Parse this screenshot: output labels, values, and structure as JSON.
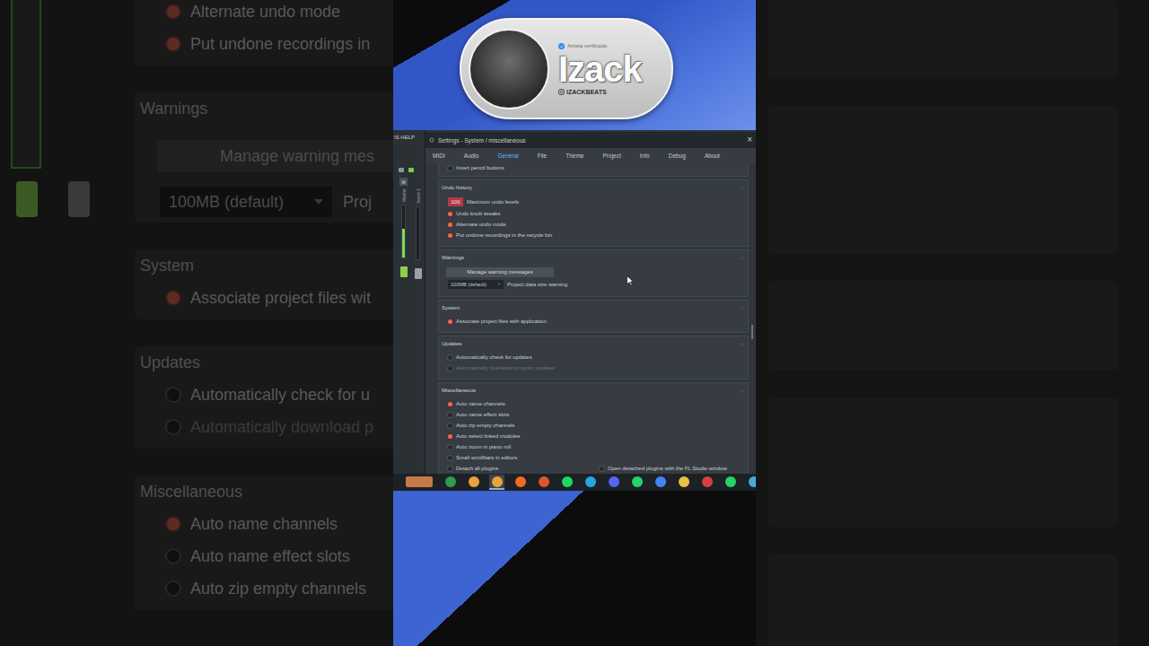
{
  "backdrop": {
    "sections": [
      {
        "items": [
          {
            "kind": "radio",
            "label": "Alternate undo mode",
            "on": true,
            "disabled": false
          },
          {
            "kind": "radio",
            "label": "Put undone recordings in",
            "on": true,
            "disabled": false
          }
        ]
      },
      {
        "title": "Warnings",
        "items": [
          {
            "kind": "button",
            "label": "Manage warning mes"
          },
          {
            "kind": "dropdown",
            "value": "100MB (default)",
            "label": "Proj"
          }
        ]
      },
      {
        "title": "System",
        "items": [
          {
            "kind": "radio",
            "label": "Associate project files wit",
            "on": true,
            "disabled": false
          }
        ]
      },
      {
        "title": "Updates",
        "items": [
          {
            "kind": "radio",
            "label": "Automatically check for u",
            "on": false,
            "disabled": false
          },
          {
            "kind": "radio",
            "label": "Automatically download p",
            "on": false,
            "disabled": true
          }
        ]
      },
      {
        "title": "Miscellaneous",
        "items": [
          {
            "kind": "radio",
            "label": "Auto name channels",
            "on": true,
            "disabled": false
          },
          {
            "kind": "radio",
            "label": "Auto name effect slots",
            "on": false,
            "disabled": false
          },
          {
            "kind": "radio",
            "label": "Auto zip empty channels",
            "on": false,
            "disabled": false
          }
        ]
      }
    ]
  },
  "badge": {
    "verified_label": "Artista verificado",
    "name": "Izack",
    "handle": "IZACKBEATS"
  },
  "screenshot": {
    "menu": "IS HELP",
    "mixer": {
      "mute_label": "M",
      "tracks": [
        {
          "name": "Master",
          "level": 0.55
        },
        {
          "name": "Insert 1",
          "level": 0
        }
      ]
    },
    "window": {
      "title": "Settings - System / miscellaneous",
      "close": "×"
    },
    "tabs": [
      {
        "label": "MIDI",
        "selected": false
      },
      {
        "label": "Audio",
        "selected": false
      },
      {
        "label": "General",
        "selected": true
      },
      {
        "label": "File",
        "selected": false
      },
      {
        "label": "Theme",
        "selected": false
      },
      {
        "label": "Project",
        "selected": false
      },
      {
        "label": "Info",
        "selected": false
      },
      {
        "label": "Debug",
        "selected": false
      },
      {
        "label": "About",
        "selected": false
      }
    ],
    "sections": [
      {
        "items": [
          {
            "kind": "radio",
            "label": "Invert pencil buttons",
            "on": false,
            "disabled": false
          }
        ]
      },
      {
        "title": "Undo history",
        "items": [
          {
            "kind": "number",
            "value": "100",
            "label": "Maximum undo levels"
          },
          {
            "kind": "radio",
            "label": "Undo knob tweaks",
            "on": true,
            "disabled": false
          },
          {
            "kind": "radio",
            "label": "Alternate undo mode",
            "on": true,
            "disabled": false
          },
          {
            "kind": "radio",
            "label": "Put undone recordings in the recycle bin",
            "on": true,
            "disabled": false
          }
        ]
      },
      {
        "title": "Warnings",
        "items": [
          {
            "kind": "button",
            "label": "Manage warning messages"
          },
          {
            "kind": "dropdown",
            "value": "100MB (default)",
            "label": "Project data size warning"
          }
        ]
      },
      {
        "title": "System",
        "items": [
          {
            "kind": "radio",
            "label": "Associate project files with application",
            "on": true,
            "disabled": false
          }
        ]
      },
      {
        "title": "Updates",
        "items": [
          {
            "kind": "radio",
            "label": "Automatically check for updates",
            "on": false,
            "disabled": false
          },
          {
            "kind": "radio",
            "label": "Automatically download program updates",
            "on": false,
            "disabled": true
          }
        ]
      },
      {
        "title": "Miscellaneous",
        "items": [
          {
            "kind": "radio",
            "label": "Auto name channels",
            "on": true,
            "disabled": false
          },
          {
            "kind": "radio",
            "label": "Auto name effect slots",
            "on": false,
            "disabled": false
          },
          {
            "kind": "radio",
            "label": "Auto zip empty channels",
            "on": false,
            "disabled": false
          },
          {
            "kind": "radio",
            "label": "Auto select linked modules",
            "on": true,
            "disabled": false
          },
          {
            "kind": "radio",
            "label": "Auto zoom in piano roll",
            "on": false,
            "disabled": false
          },
          {
            "kind": "radio",
            "label": "Small scrollbars in editors",
            "on": false,
            "disabled": false
          },
          {
            "kind": "radio",
            "label": "Detach all plugins",
            "on": false,
            "disabled": false,
            "aside": {
              "label": "Open detached plugins with the FL Studio window",
              "on": false
            }
          }
        ]
      }
    ],
    "taskbar": [
      {
        "selected": false
      },
      {
        "selected": false
      },
      {
        "selected": false
      },
      {
        "selected": true
      },
      {
        "selected": false
      },
      {
        "selected": false
      },
      {
        "selected": false
      },
      {
        "selected": false
      },
      {
        "selected": false
      },
      {
        "selected": false
      },
      {
        "selected": false
      },
      {
        "selected": false
      },
      {
        "selected": false
      },
      {
        "selected": false
      },
      {
        "selected": false
      }
    ]
  }
}
